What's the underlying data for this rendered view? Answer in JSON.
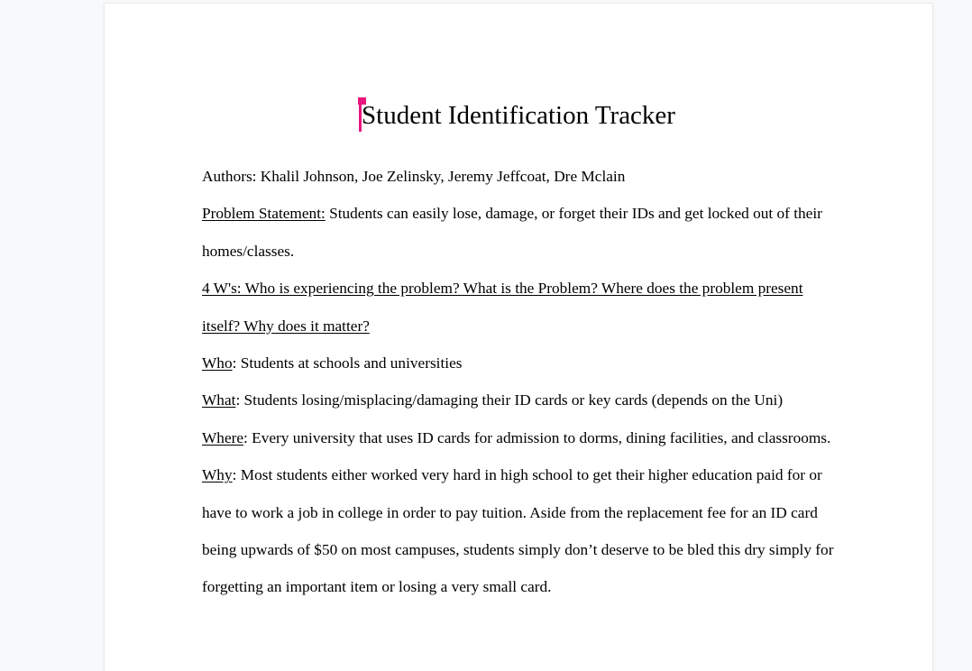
{
  "document": {
    "title": "Student Identification Tracker",
    "authors": "Authors: Khalil Johnson, Joe Zelinsky, Jeremy Jeffcoat, Dre Mclain",
    "problem": {
      "label": "Problem Statement:",
      "text": " Students can easily lose, damage, or forget their IDs and get locked out of their homes/classes."
    },
    "four_ws_heading": "4 W's: Who is experiencing the problem?  What is the Problem? Where does the problem present itself? Why does it matter?",
    "who": {
      "label": "Who",
      "text": ": Students at schools and universities"
    },
    "what": {
      "label": "What",
      "text": ": Students losing/misplacing/damaging their ID cards or key cards (depends on the Uni)"
    },
    "where": {
      "label": "Where",
      "text": ": Every university that uses ID cards for admission to dorms, dining facilities, and classrooms."
    },
    "why": {
      "label": "Why",
      "text": ": Most students either worked very hard in high school to get their higher education paid for or have to work a job in college in order to pay tuition. Aside from the replacement fee for an ID card being upwards of $50 on most campuses, students simply don’t deserve to be bled this dry simply for forgetting an important item or losing a very small card."
    }
  },
  "colors": {
    "cursor": "#e8177d",
    "page_background": "#ffffff",
    "canvas_background": "#f8f9fa"
  }
}
